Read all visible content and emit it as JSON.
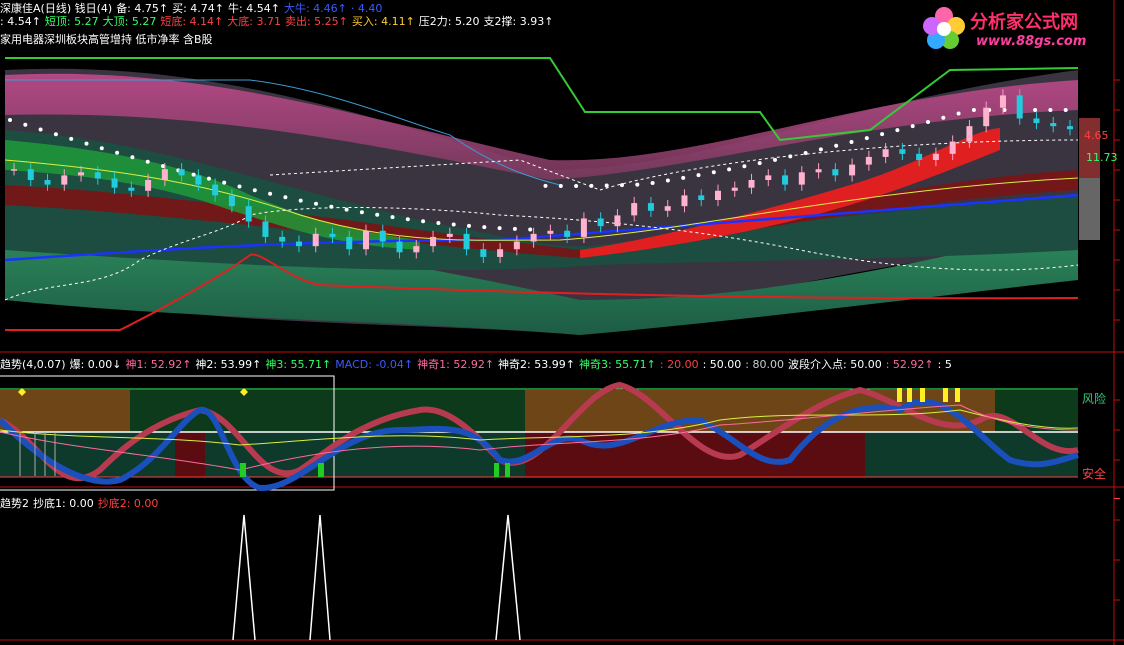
{
  "header": {
    "row1": [
      {
        "text": "深康佳A(日线) 钱日(4)",
        "color": "#ffffff"
      },
      {
        "text": "备: 4.75↑",
        "color": "#ffffff"
      },
      {
        "text": "买: 4.74↑",
        "color": "#ffffff"
      },
      {
        "text": "牛: 4.54↑",
        "color": "#ffffff"
      },
      {
        "text": "大牛: 4.46↑",
        "color": "#3b5bff"
      },
      {
        "text": "· 4.40",
        "color": "#3b5bff"
      }
    ],
    "row2": [
      {
        "text": ": 4.54↑",
        "color": "#ffffff"
      },
      {
        "text": "短顶: 5.27",
        "color": "#33ff66"
      },
      {
        "text": "大顶: 5.27",
        "color": "#33ff66"
      },
      {
        "text": "短底: 4.14↑",
        "color": "#ff4040"
      },
      {
        "text": "大底: 3.71",
        "color": "#ff4040"
      },
      {
        "text": "卖出: 5.25↑",
        "color": "#ff4040"
      },
      {
        "text": "买入: 4.11↑",
        "color": "#ffcc33"
      },
      {
        "text": "压2力: 5.20",
        "color": "#ffffff"
      },
      {
        "text": "支2撑: 3.93↑",
        "color": "#ffffff"
      }
    ],
    "row3": "家用电器深圳板块高管增持 低市净率 含B股"
  },
  "logo": {
    "title": "分析家公式网",
    "url": "www.88gs.com"
  },
  "price_labels": [
    "4.65",
    "11.73"
  ],
  "indicator_header": [
    {
      "text": "趋势(4,0.07)",
      "color": "#ffffff"
    },
    {
      "text": "爆: 0.00↓",
      "color": "#ffffff"
    },
    {
      "text": "神1: 52.92↑",
      "color": "#ff6b9d"
    },
    {
      "text": "神2: 53.99↑",
      "color": "#ffffff"
    },
    {
      "text": "神3: 55.71↑",
      "color": "#33ff66"
    },
    {
      "text": "MACD: -0.04↑",
      "color": "#3b5bff"
    },
    {
      "text": "神奇1: 52.92↑",
      "color": "#ff6b9d"
    },
    {
      "text": "神奇2: 53.99↑",
      "color": "#ffffff"
    },
    {
      "text": "神奇3: 55.71↑",
      "color": "#33ff66"
    },
    {
      "text": ": 20.00",
      "color": "#ff4040"
    },
    {
      "text": ": 50.00",
      "color": "#ffffff"
    },
    {
      "text": ": 80.00",
      "color": "#cccccc"
    },
    {
      "text": "波段介入点: 50.00",
      "color": "#ffffff"
    },
    {
      "text": ": 52.92↑",
      "color": "#ff6b9d"
    },
    {
      "text": ": 5",
      "color": "#ffffff"
    }
  ],
  "risk_label": "风险",
  "safe_label": "安全",
  "bottom_header": [
    {
      "text": "趋势2",
      "color": "#ffffff"
    },
    {
      "text": "抄底1: 0.00",
      "color": "#ffffff"
    },
    {
      "text": "抄底2: 0.00",
      "color": "#ff4040"
    }
  ],
  "chart_data": {
    "type": "line",
    "panels": [
      {
        "name": "K线",
        "type": "candlestick",
        "close": [
          4.62,
          4.55,
          4.52,
          4.58,
          4.6,
          4.56,
          4.5,
          4.48,
          4.55,
          4.62,
          4.58,
          4.52,
          4.45,
          4.38,
          4.28,
          4.18,
          4.15,
          4.12,
          4.2,
          4.18,
          4.1,
          4.22,
          4.15,
          4.08,
          4.12,
          4.18,
          4.2,
          4.1,
          4.05,
          4.1,
          4.15,
          4.2,
          4.22,
          4.18,
          4.3,
          4.25,
          4.32,
          4.4,
          4.35,
          4.38,
          4.45,
          4.42,
          4.48,
          4.5,
          4.55,
          4.58,
          4.52,
          4.6,
          4.62,
          4.58,
          4.65,
          4.7,
          4.75,
          4.72,
          4.68,
          4.72,
          4.8,
          4.9,
          5.02,
          5.1,
          4.95,
          4.92,
          4.9,
          4.88
        ]
      },
      {
        "name": "趋势",
        "type": "oscillator",
        "levels": [
          20,
          50,
          80
        ]
      },
      {
        "name": "趋势2",
        "type": "spike",
        "spikes_at": [
          12,
          16,
          26
        ]
      }
    ]
  }
}
